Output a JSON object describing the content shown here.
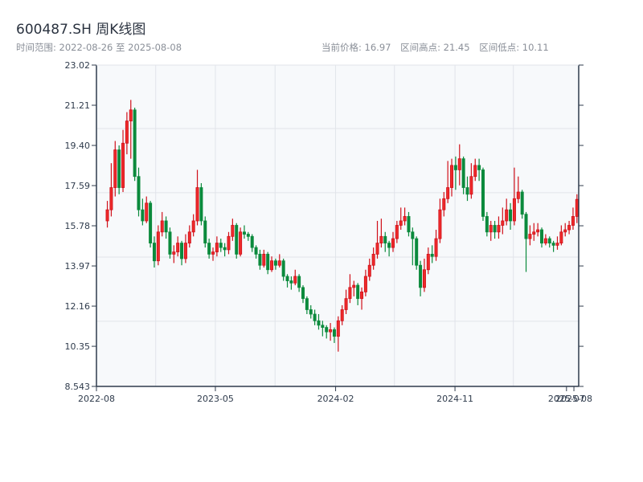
{
  "header": {
    "title": "600487.SH 周K线图",
    "range_label": "时间范围: 2022-08-26 至 2025-08-08",
    "current_price": "当前价格: 16.97",
    "range_high": "区间高点: 21.45",
    "range_low": "区间低点: 10.11"
  },
  "colors": {
    "up": "#d0101a",
    "up_fill": "#ee2a2a",
    "down": "#0b8a3c",
    "axis": "#2f3b4c",
    "grid": "#e1e4ea",
    "plot_bg": "#f7f9fb"
  },
  "chart_data": {
    "type": "candlestick",
    "title": "600487.SH 周K线图",
    "xlabel": "",
    "ylabel": "",
    "ylim": [
      8.543,
      23.02
    ],
    "xlim": [
      "2022-08-01",
      "2025-08-12"
    ],
    "yticks": [
      "23.02",
      "21.21",
      "19.40",
      "17.59",
      "15.78",
      "13.97",
      "12.16",
      "10.35",
      "8.543"
    ],
    "grid_y": [
      20.16,
      17.27,
      14.37,
      11.48
    ],
    "grid_x": [
      "2022-12-15",
      "2023-05-01",
      "2023-09-15",
      "2024-02-01",
      "2024-06-15",
      "2024-11-01",
      "2025-03-15"
    ],
    "xticks": [
      {
        "label": "2022-08",
        "date": "2022-08-01"
      },
      {
        "label": "2023-05",
        "date": "2023-05-01"
      },
      {
        "label": "2024-02",
        "date": "2024-02-01"
      },
      {
        "label": "2024-11",
        "date": "2024-11-01"
      },
      {
        "label": "2025-07",
        "date": "2025-07-15"
      },
      {
        "label": "2025-08",
        "date": "2025-08-01"
      }
    ],
    "candle_range": [
      "2022-08-26",
      "2025-08-08"
    ],
    "ohlc_fields": [
      "open",
      "high",
      "low",
      "close"
    ],
    "ohlc": [
      [
        16.0,
        16.9,
        15.7,
        16.5
      ],
      [
        16.5,
        18.6,
        16.2,
        17.5
      ],
      [
        17.5,
        19.6,
        17.1,
        19.2
      ],
      [
        19.2,
        19.4,
        17.2,
        17.5
      ],
      [
        17.5,
        20.1,
        17.3,
        19.5
      ],
      [
        19.5,
        20.9,
        19.0,
        20.5
      ],
      [
        20.5,
        21.45,
        18.8,
        21.0
      ],
      [
        21.0,
        21.1,
        17.8,
        18.0
      ],
      [
        18.0,
        18.4,
        16.2,
        16.5
      ],
      [
        16.5,
        17.0,
        15.8,
        16.0
      ],
      [
        16.0,
        17.1,
        15.9,
        16.8
      ],
      [
        16.8,
        16.9,
        14.8,
        15.0
      ],
      [
        15.0,
        15.3,
        13.9,
        14.2
      ],
      [
        14.2,
        15.8,
        14.0,
        15.5
      ],
      [
        15.5,
        16.4,
        15.3,
        16.0
      ],
      [
        16.0,
        16.2,
        15.2,
        15.5
      ],
      [
        15.5,
        15.7,
        14.3,
        14.5
      ],
      [
        14.5,
        14.9,
        14.1,
        14.6
      ],
      [
        14.6,
        15.3,
        14.4,
        15.0
      ],
      [
        15.0,
        15.1,
        14.0,
        14.3
      ],
      [
        14.3,
        15.4,
        14.1,
        15.0
      ],
      [
        15.0,
        15.8,
        14.8,
        15.5
      ],
      [
        15.5,
        16.3,
        15.3,
        16.0
      ],
      [
        16.0,
        18.3,
        15.8,
        17.5
      ],
      [
        17.5,
        17.7,
        15.8,
        16.0
      ],
      [
        16.0,
        16.2,
        14.8,
        15.0
      ],
      [
        15.0,
        15.2,
        14.3,
        14.5
      ],
      [
        14.5,
        14.8,
        14.2,
        14.6
      ],
      [
        14.6,
        15.3,
        14.4,
        15.0
      ],
      [
        15.0,
        15.2,
        14.6,
        14.8
      ],
      [
        14.8,
        15.0,
        14.4,
        14.7
      ],
      [
        14.7,
        15.5,
        14.5,
        15.3
      ],
      [
        15.3,
        16.1,
        15.1,
        15.8
      ],
      [
        15.8,
        15.9,
        14.3,
        14.5
      ],
      [
        14.5,
        15.7,
        14.4,
        15.5
      ],
      [
        15.5,
        15.8,
        15.2,
        15.4
      ],
      [
        15.4,
        15.5,
        15.1,
        15.3
      ],
      [
        15.3,
        15.4,
        14.6,
        14.8
      ],
      [
        14.8,
        14.9,
        14.3,
        14.5
      ],
      [
        14.5,
        14.7,
        13.8,
        14.0
      ],
      [
        14.0,
        14.7,
        13.9,
        14.5
      ],
      [
        14.5,
        14.6,
        13.6,
        13.8
      ],
      [
        13.8,
        14.4,
        13.7,
        14.2
      ],
      [
        14.2,
        14.3,
        13.8,
        14.0
      ],
      [
        14.0,
        14.5,
        13.9,
        14.2
      ],
      [
        14.2,
        14.3,
        13.3,
        13.5
      ],
      [
        13.5,
        13.6,
        13.0,
        13.3
      ],
      [
        13.3,
        13.5,
        12.9,
        13.2
      ],
      [
        13.2,
        13.8,
        13.1,
        13.5
      ],
      [
        13.5,
        13.6,
        12.8,
        13.0
      ],
      [
        13.0,
        13.1,
        12.3,
        12.5
      ],
      [
        12.5,
        12.6,
        11.8,
        12.0
      ],
      [
        12.0,
        12.2,
        11.6,
        11.8
      ],
      [
        11.8,
        12.0,
        11.3,
        11.5
      ],
      [
        11.5,
        11.8,
        11.1,
        11.3
      ],
      [
        11.3,
        11.5,
        10.8,
        11.2
      ],
      [
        11.2,
        11.3,
        10.7,
        11.0
      ],
      [
        11.0,
        11.4,
        10.6,
        11.1
      ],
      [
        11.1,
        11.2,
        10.5,
        10.8
      ],
      [
        10.8,
        11.7,
        10.11,
        11.5
      ],
      [
        11.5,
        12.2,
        11.3,
        12.0
      ],
      [
        12.0,
        12.9,
        11.8,
        12.5
      ],
      [
        12.5,
        13.6,
        12.3,
        13.0
      ],
      [
        13.0,
        13.3,
        12.6,
        13.1
      ],
      [
        13.1,
        13.2,
        12.2,
        12.5
      ],
      [
        12.5,
        13.0,
        12.0,
        12.8
      ],
      [
        12.8,
        13.8,
        12.6,
        13.5
      ],
      [
        13.5,
        14.3,
        13.3,
        14.0
      ],
      [
        14.0,
        14.8,
        13.8,
        14.5
      ],
      [
        14.5,
        16.0,
        14.3,
        15.0
      ],
      [
        15.0,
        16.1,
        14.8,
        15.3
      ],
      [
        15.3,
        15.5,
        14.6,
        15.0
      ],
      [
        15.0,
        15.1,
        14.4,
        14.8
      ],
      [
        14.8,
        15.5,
        14.6,
        15.2
      ],
      [
        15.2,
        16.0,
        15.0,
        15.8
      ],
      [
        15.8,
        16.6,
        15.6,
        16.0
      ],
      [
        16.0,
        16.6,
        15.8,
        16.2
      ],
      [
        16.2,
        16.4,
        15.3,
        15.5
      ],
      [
        15.5,
        15.7,
        14.0,
        15.2
      ],
      [
        15.2,
        15.3,
        13.8,
        14.0
      ],
      [
        14.0,
        14.2,
        12.6,
        13.0
      ],
      [
        13.0,
        14.3,
        12.8,
        13.8
      ],
      [
        13.8,
        14.8,
        13.6,
        14.5
      ],
      [
        14.5,
        14.9,
        14.1,
        14.4
      ],
      [
        14.4,
        15.6,
        14.2,
        15.2
      ],
      [
        15.2,
        17.0,
        15.0,
        16.5
      ],
      [
        16.5,
        17.3,
        16.2,
        17.0
      ],
      [
        17.0,
        18.7,
        16.8,
        17.5
      ],
      [
        17.5,
        18.8,
        17.1,
        18.5
      ],
      [
        18.5,
        18.9,
        17.4,
        18.3
      ],
      [
        18.3,
        19.45,
        17.6,
        18.8
      ],
      [
        18.8,
        18.9,
        17.2,
        17.5
      ],
      [
        17.5,
        18.0,
        16.9,
        17.2
      ],
      [
        17.2,
        18.6,
        17.0,
        18.0
      ],
      [
        18.0,
        18.8,
        17.8,
        18.5
      ],
      [
        18.5,
        18.8,
        17.8,
        18.3
      ],
      [
        18.3,
        18.4,
        16.0,
        16.2
      ],
      [
        16.2,
        16.4,
        15.3,
        15.5
      ],
      [
        15.5,
        16.0,
        15.1,
        15.8
      ],
      [
        15.8,
        16.0,
        15.2,
        15.5
      ],
      [
        15.5,
        16.2,
        15.2,
        15.8
      ],
      [
        15.8,
        16.6,
        15.4,
        16.0
      ],
      [
        16.0,
        17.0,
        15.8,
        16.5
      ],
      [
        16.5,
        16.8,
        15.6,
        16.0
      ],
      [
        16.0,
        18.4,
        15.8,
        17.0
      ],
      [
        17.0,
        18.0,
        16.8,
        17.3
      ],
      [
        17.3,
        17.4,
        16.1,
        16.3
      ],
      [
        16.3,
        16.4,
        13.7,
        15.2
      ],
      [
        15.2,
        15.8,
        14.9,
        15.4
      ],
      [
        15.4,
        15.9,
        15.1,
        15.5
      ],
      [
        15.5,
        15.9,
        15.3,
        15.6
      ],
      [
        15.6,
        15.7,
        14.8,
        15.0
      ],
      [
        15.0,
        15.4,
        14.9,
        15.2
      ],
      [
        15.2,
        15.3,
        14.8,
        15.0
      ],
      [
        15.0,
        15.1,
        14.6,
        14.9
      ],
      [
        14.9,
        15.3,
        14.7,
        15.0
      ],
      [
        15.0,
        15.8,
        14.9,
        15.5
      ],
      [
        15.5,
        15.9,
        15.3,
        15.6
      ],
      [
        15.6,
        16.0,
        15.4,
        15.8
      ],
      [
        15.8,
        16.6,
        15.6,
        16.2
      ],
      [
        16.2,
        17.2,
        15.9,
        16.97
      ]
    ]
  }
}
